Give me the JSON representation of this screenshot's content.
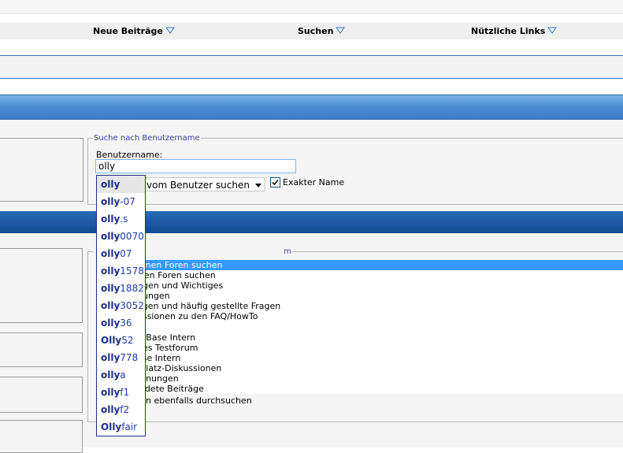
{
  "nav": {
    "items": [
      {
        "label": "Neue Beiträge"
      },
      {
        "label": "Suchen"
      },
      {
        "label": "Nützliche Links"
      }
    ]
  },
  "user_search": {
    "legend": "Suche nach Benutzername",
    "label": "Benutzername:",
    "value": "olly",
    "select_value": "vom Benutzer suchen",
    "exact_label": "Exakter Name",
    "exact_checked": true
  },
  "forum_search": {
    "legend": "m",
    "items": [
      {
        "label": "fenen Foren suchen",
        "selected": true
      },
      {
        "label": "rten Foren suchen"
      },
      {
        "label": "ngen und Wichtiges"
      },
      {
        "label": "gungen"
      },
      {
        "label": "agen und häufig gestellte Fragen"
      },
      {
        "label": "ussionen zu den FAQ/HowTo"
      }
    ],
    "items2": [
      {
        "label": "erBase Intern"
      },
      {
        "label": "nes Testforum"
      },
      {
        "label": "ase Intern"
      },
      {
        "label": "tplatz-Diskussionen"
      },
      {
        "label": "arnungen"
      },
      {
        "label": "eldete Beiträge"
      }
    ],
    "subforums_label": "ren ebenfalls durchsuchen"
  },
  "autocomplete": {
    "query": "olly",
    "items": [
      {
        "match": "olly",
        "rest": ""
      },
      {
        "match": "olly",
        "rest": "-07"
      },
      {
        "match": "olly",
        "rest": ".s"
      },
      {
        "match": "olly",
        "rest": "0070"
      },
      {
        "match": "olly",
        "rest": "07"
      },
      {
        "match": "olly",
        "rest": "1578"
      },
      {
        "match": "olly",
        "rest": "1882"
      },
      {
        "match": "olly",
        "rest": "3052"
      },
      {
        "match": "olly",
        "rest": "36"
      },
      {
        "match": "Olly",
        "rest": "52"
      },
      {
        "match": "olly",
        "rest": "778"
      },
      {
        "match": "olly",
        "rest": "a"
      },
      {
        "match": "olly",
        "rest": "f1"
      },
      {
        "match": "olly",
        "rest": "f2"
      },
      {
        "match": "Olly",
        "rest": "fair"
      }
    ]
  },
  "colors": {
    "accent_blue": "#3e77b3",
    "header_bar": "#4d8ed3",
    "dark_bar": "#1c5aa3",
    "selection": "#3399ff"
  },
  "icons": {
    "nav_dropdown": "triangle-down-icon",
    "select_arrow": "chevron-down-icon",
    "checkbox": "checkmark-icon"
  }
}
